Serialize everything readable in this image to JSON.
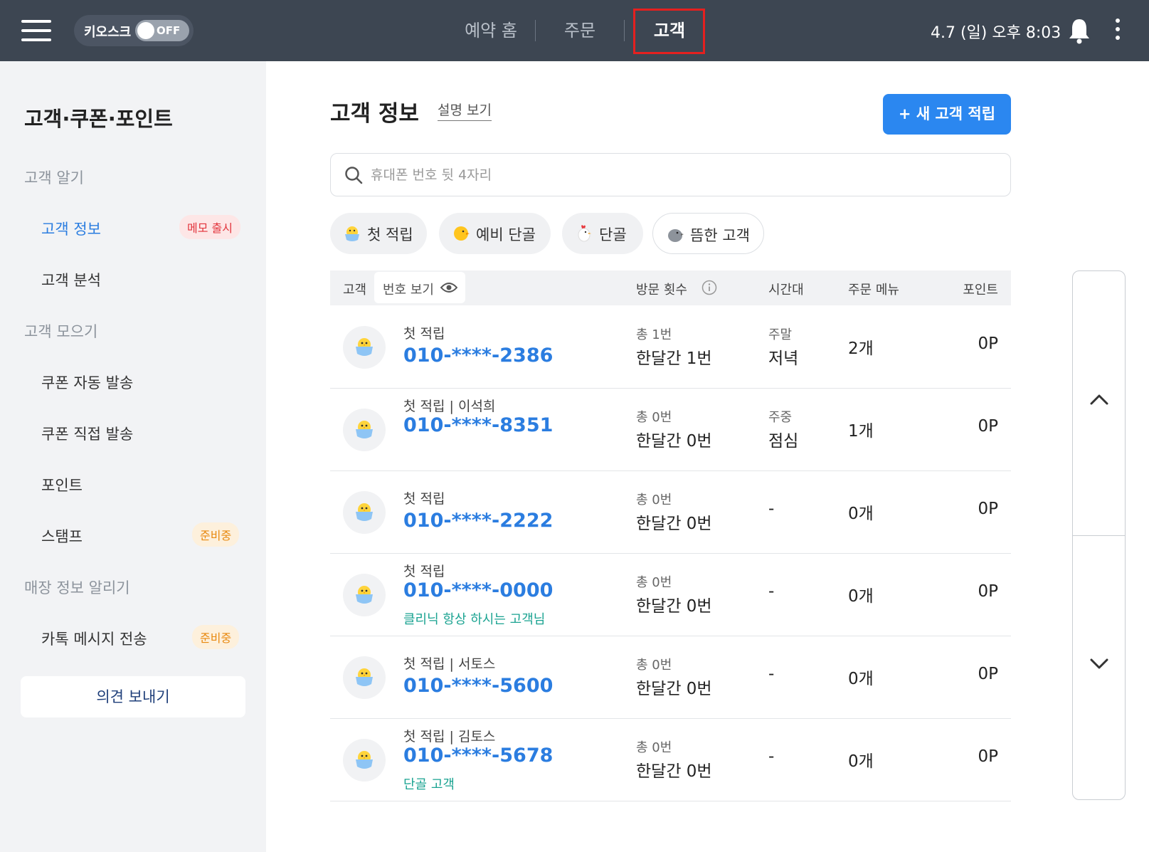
{
  "topbar": {
    "kiosk_label": "키오스크",
    "kiosk_state": "OFF",
    "tabs": [
      {
        "label": "예약 홈"
      },
      {
        "label": "주문"
      },
      {
        "label": "고객"
      }
    ],
    "active_tab": "고객",
    "datetime": "4.7 (일) 오후 8:03"
  },
  "sidebar": {
    "title": "고객·쿠폰·포인트",
    "sections": [
      {
        "label": "고객 알기"
      },
      {
        "label": "고객 모으기"
      },
      {
        "label": "매장 정보 알리기"
      }
    ],
    "items": [
      {
        "label": "고객 정보",
        "badge": "메모 출시",
        "active": true
      },
      {
        "label": "고객 분석"
      },
      {
        "label": "쿠폰 자동 발송"
      },
      {
        "label": "쿠폰 직접 발송"
      },
      {
        "label": "포인트"
      },
      {
        "label": "스탬프",
        "badge": "준비중"
      },
      {
        "label": "카톡 메시지 전송",
        "badge": "준비중"
      }
    ],
    "feedback_label": "의견 보내기"
  },
  "main": {
    "title": "고객 정보",
    "help_link": "설명 보기",
    "new_button": "+ 새 고객 적립",
    "search_placeholder": "휴대폰 번호 뒷 4자리",
    "filters": [
      {
        "label": "첫 적립",
        "icon": "chick-icon"
      },
      {
        "label": "예비 단골",
        "icon": "yellow-chick-icon"
      },
      {
        "label": "단골",
        "icon": "chicken-icon"
      },
      {
        "label": "뜸한 고객",
        "icon": "gray-bird-icon"
      }
    ],
    "table": {
      "headers": {
        "customer": "고객",
        "reveal": "번호 보기",
        "visits": "방문 횟수",
        "timeslot": "시간대",
        "menu": "주문 메뉴",
        "points": "포인트"
      },
      "rows": [
        {
          "tag": "첫 적립",
          "phone": "010-****-2386",
          "memo": "",
          "visit_total": "총 1번",
          "visit_month": "한달간 1번",
          "time_top": "주말",
          "time_main": "저녁",
          "menu": "2개",
          "points": "0P"
        },
        {
          "tag": "첫 적립 | 이석희",
          "phone": "010-****-8351",
          "memo": "",
          "visit_total": "총 0번",
          "visit_month": "한달간 0번",
          "time_top": "주중",
          "time_main": "점심",
          "menu": "1개",
          "points": "0P"
        },
        {
          "tag": "첫 적립",
          "phone": "010-****-2222",
          "memo": "",
          "visit_total": "총 0번",
          "visit_month": "한달간 0번",
          "time_top": "",
          "time_main": "-",
          "menu": "0개",
          "points": "0P"
        },
        {
          "tag": "첫 적립",
          "phone": "010-****-0000",
          "memo": "클리닉 항상 하시는 고객님",
          "visit_total": "총 0번",
          "visit_month": "한달간 0번",
          "time_top": "",
          "time_main": "-",
          "menu": "0개",
          "points": "0P"
        },
        {
          "tag": "첫 적립 | 서토스",
          "phone": "010-****-5600",
          "memo": "",
          "visit_total": "총 0번",
          "visit_month": "한달간 0번",
          "time_top": "",
          "time_main": "-",
          "menu": "0개",
          "points": "0P"
        },
        {
          "tag": "첫 적립 | 김토스",
          "phone": "010-****-5678",
          "memo": "단골 고객",
          "visit_total": "총 0번",
          "visit_month": "한달간 0번",
          "time_top": "",
          "time_main": "-",
          "menu": "0개",
          "points": "0P"
        }
      ]
    }
  },
  "colors": {
    "topbar": "#3d4652",
    "accent_blue": "#2b87f0",
    "phone_blue": "#2b7de0",
    "memo_teal": "#1aa391",
    "highlight_red": "#e5201f"
  }
}
